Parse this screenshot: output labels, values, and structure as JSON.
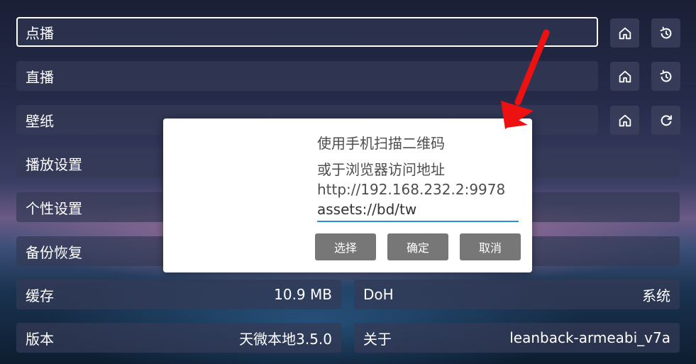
{
  "settings": {
    "vod_label": "点播",
    "live_label": "直播",
    "wallpaper_label": "壁纸",
    "playback_label": "播放设置",
    "personal_label": "个性设置",
    "backup_label": "备份恢复",
    "cache_label": "缓存",
    "cache_value": "10.9 MB",
    "doh_label": "DoH",
    "doh_value": "系统",
    "version_label": "版本",
    "version_value": "天微本地3.5.0",
    "about_label": "关于",
    "about_value": "leanback-armeabi_v7a"
  },
  "dialog": {
    "line1": "使用手机扫描二维码",
    "line2": "或于浏览器访问地址",
    "address": "http://192.168.232.2:9978",
    "input_value": "assets://bd/tw",
    "select_label": "选择",
    "confirm_label": "确定",
    "cancel_label": "取消"
  },
  "icons": {
    "home": "home-icon",
    "history": "history-icon",
    "refresh": "refresh-icon",
    "annotation": "red-arrow"
  },
  "colors": {
    "input_underline": "#2b8fe0",
    "dialog_button": "#777777",
    "annotation_arrow": "#ee1111"
  }
}
